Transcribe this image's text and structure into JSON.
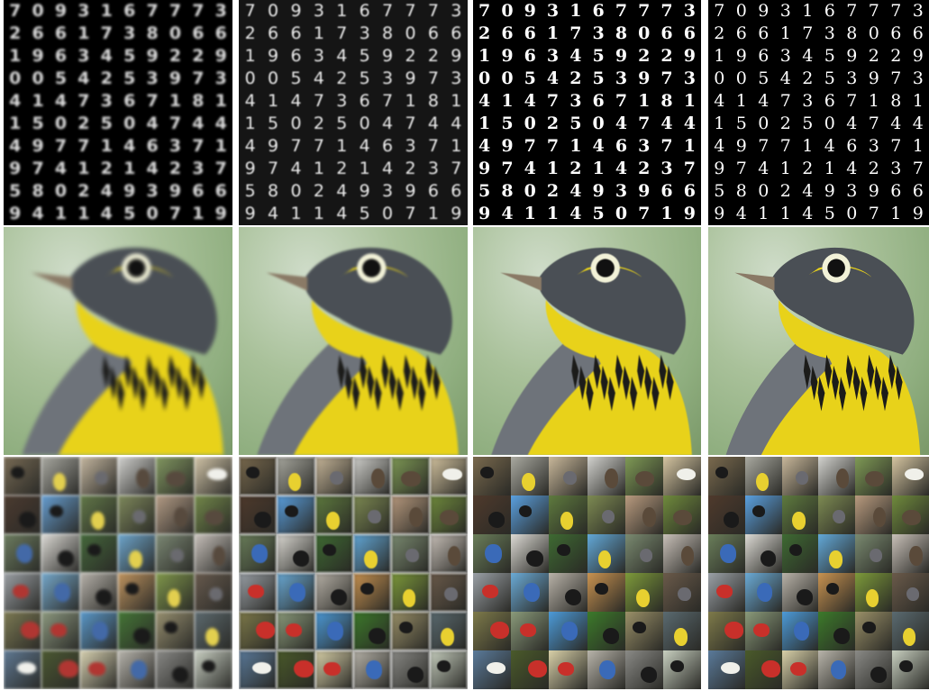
{
  "figure": {
    "columns": [
      "col-1",
      "col-2",
      "col-3",
      "col-4"
    ],
    "digit_grid": [
      [
        "7",
        "0",
        "9",
        "3",
        "1",
        "6",
        "7",
        "7",
        "7",
        "3"
      ],
      [
        "2",
        "6",
        "6",
        "1",
        "7",
        "3",
        "8",
        "0",
        "6",
        "6"
      ],
      [
        "1",
        "9",
        "6",
        "3",
        "4",
        "5",
        "9",
        "2",
        "2",
        "9"
      ],
      [
        "0",
        "0",
        "5",
        "4",
        "2",
        "5",
        "3",
        "9",
        "7",
        "3"
      ],
      [
        "4",
        "1",
        "4",
        "7",
        "3",
        "6",
        "7",
        "1",
        "8",
        "1"
      ],
      [
        "1",
        "5",
        "0",
        "2",
        "5",
        "0",
        "4",
        "7",
        "4",
        "4"
      ],
      [
        "4",
        "9",
        "7",
        "7",
        "1",
        "4",
        "6",
        "3",
        "7",
        "1"
      ],
      [
        "9",
        "7",
        "4",
        "1",
        "2",
        "1",
        "4",
        "2",
        "3",
        "7"
      ],
      [
        "5",
        "8",
        "0",
        "2",
        "4",
        "9",
        "3",
        "9",
        "6",
        "6"
      ],
      [
        "9",
        "4",
        "1",
        "1",
        "4",
        "5",
        "0",
        "7",
        "1",
        "9"
      ]
    ],
    "bird_colors": {
      "background": "#9fb98f",
      "head": "#4a4f55",
      "throat": "#e8d21a",
      "eye_ring": "#f2f2d8",
      "beak": "#8a7a66",
      "wing": "#6e737a",
      "streaks": "#1c1c1a"
    },
    "mosaic_tiles": [
      [
        "#7a6a4e",
        "#a9a9a0",
        "#c8b79a",
        "#d2d2ce",
        "#7f9a55",
        "#d4c4a0"
      ],
      [
        "#4f3a2c",
        "#5aa0e0",
        "#5e7a3e",
        "#7d8a52",
        "#b89a7e",
        "#6f8a3c"
      ],
      [
        "#6a7e5a",
        "#dcdad4",
        "#3e6a32",
        "#62a8d8",
        "#7a8a70",
        "#c8c0b8"
      ],
      [
        "#9aa0a6",
        "#6aaad6",
        "#b8b2a8",
        "#c89250",
        "#7d9a3a",
        "#6a5a4a"
      ],
      [
        "#7e7a4a",
        "#8a9a7a",
        "#4c9ad8",
        "#3c7a2a",
        "#9a9068",
        "#5a6a70"
      ],
      [
        "#5a7a9a",
        "#4a5a2a",
        "#d8d0a8",
        "#b8b4aa",
        "#8a8a86",
        "#c8d0c0"
      ]
    ]
  }
}
